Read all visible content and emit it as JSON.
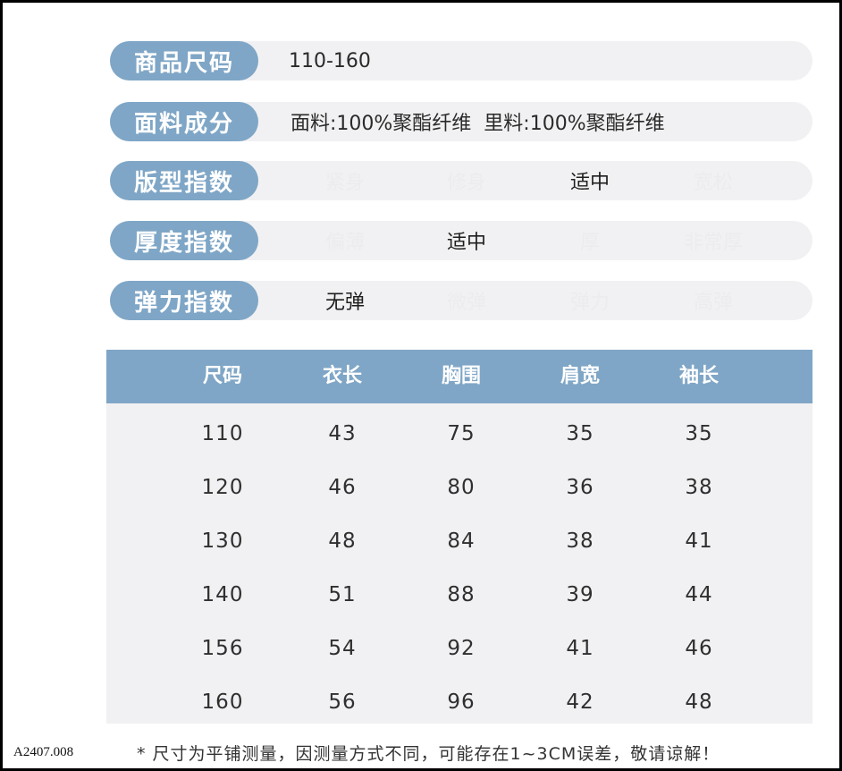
{
  "attributes": {
    "size": {
      "label": "商品尺码",
      "value": "110-160"
    },
    "fabric": {
      "label": "面料成分",
      "value": "面料:100%聚酯纤维  里料:100%聚酯纤维"
    },
    "fit": {
      "label": "版型指数",
      "options": [
        "紧身",
        "修身",
        "适中",
        "宽松"
      ],
      "selected": "适中"
    },
    "thickness": {
      "label": "厚度指数",
      "options": [
        "偏薄",
        "适中",
        "厚",
        "非常厚"
      ],
      "selected": "适中"
    },
    "elasticity": {
      "label": "弹力指数",
      "options": [
        "无弹",
        "微弹",
        "弹力",
        "高弹"
      ],
      "selected": "无弹"
    }
  },
  "size_table": {
    "headers": [
      "尺码",
      "衣长",
      "胸围",
      "肩宽",
      "袖长"
    ],
    "rows": [
      [
        "110",
        "43",
        "75",
        "35",
        "35"
      ],
      [
        "120",
        "46",
        "80",
        "36",
        "38"
      ],
      [
        "130",
        "48",
        "84",
        "38",
        "41"
      ],
      [
        "140",
        "51",
        "88",
        "39",
        "44"
      ],
      [
        "156",
        "54",
        "92",
        "41",
        "46"
      ],
      [
        "160",
        "56",
        "96",
        "42",
        "48"
      ]
    ]
  },
  "note": "* 尺寸为平铺测量，因测量方式不同，可能存在1~3CM误差，敬请谅解！",
  "product_code": "A2407.008",
  "colors": {
    "accent": "#7fa6c6",
    "row_bg": "#f1f1f3"
  }
}
